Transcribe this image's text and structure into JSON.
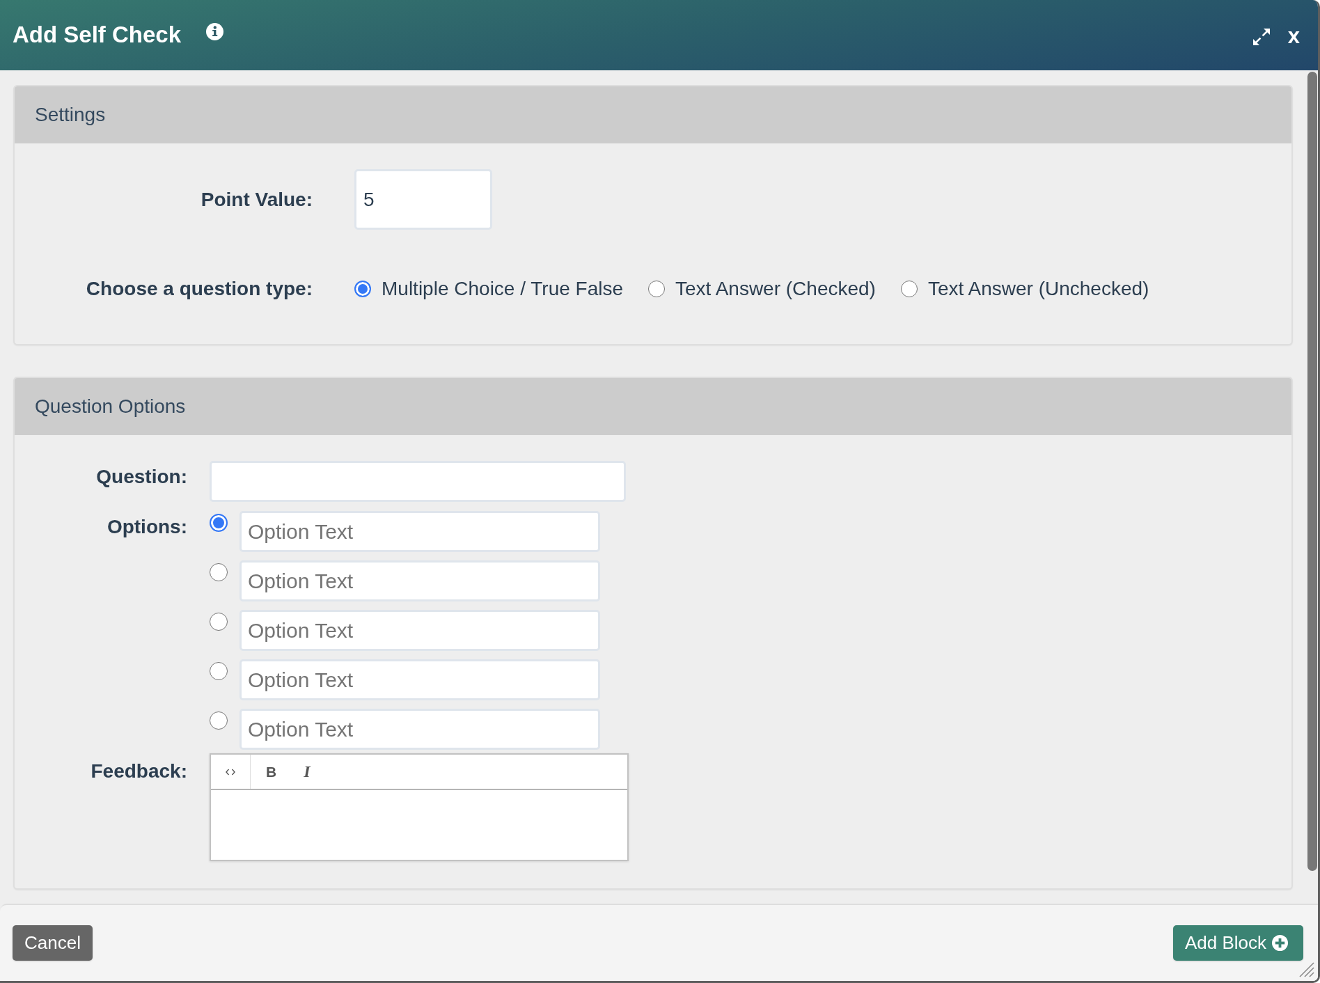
{
  "dialog": {
    "title": "Add Self Check",
    "close": "x"
  },
  "settings": {
    "title": "Settings",
    "point_value": {
      "label": "Point Value:",
      "value": "5"
    },
    "question_type": {
      "label": "Choose a question type:",
      "options": [
        {
          "label": "Multiple Choice / True False",
          "selected": true
        },
        {
          "label": "Text Answer (Checked)",
          "selected": false
        },
        {
          "label": "Text Answer (Unchecked)",
          "selected": false
        }
      ]
    }
  },
  "question_options": {
    "title": "Question Options",
    "question": {
      "label": "Question:"
    },
    "options": {
      "label": "Options:",
      "items": [
        {
          "placeholder": "Option Text",
          "selected": true
        },
        {
          "placeholder": "Option Text",
          "selected": false
        },
        {
          "placeholder": "Option Text",
          "selected": false
        },
        {
          "placeholder": "Option Text",
          "selected": false
        },
        {
          "placeholder": "Option Text",
          "selected": false
        }
      ]
    },
    "feedback": {
      "label": "Feedback:",
      "toolbar": [
        {
          "kind": "code"
        },
        {
          "kind": "bold",
          "label": "B"
        },
        {
          "kind": "italic",
          "label": "I"
        }
      ]
    }
  },
  "footer": {
    "buttons": [
      {
        "kind": "secondary",
        "label": "Cancel"
      },
      {
        "kind": "primary",
        "label": "Add Block"
      }
    ]
  }
}
